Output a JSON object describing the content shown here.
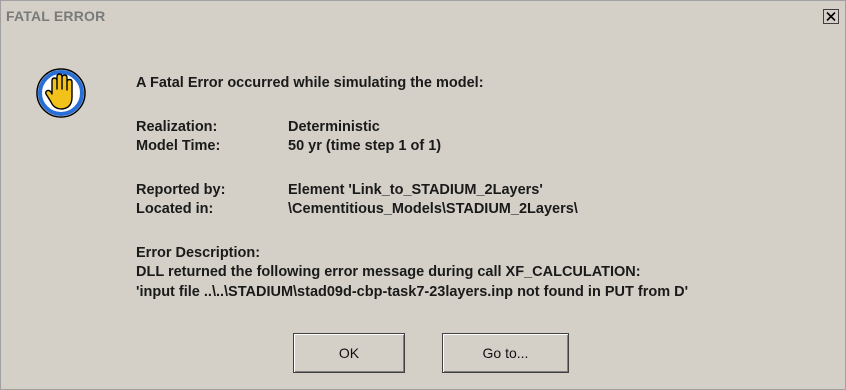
{
  "dialog": {
    "title": "FATAL ERROR",
    "close_label": "X",
    "icon": "stop-hand-icon",
    "headline": "A Fatal Error occurred while simulating the model:",
    "realization_label": "Realization:",
    "realization_value": "Deterministic",
    "model_time_label": "Model Time:",
    "model_time_value": "50 yr  (time step 1 of 1)",
    "reported_by_label": "Reported by:",
    "reported_by_value": "Element 'Link_to_STADIUM_2Layers'",
    "located_in_label": "Located in:",
    "located_in_value": "\\Cementitious_Models\\STADIUM_2Layers\\",
    "error_description_label": "Error Description:",
    "error_line_1": "DLL returned the following error message during call XF_CALCULATION:",
    "error_line_2": "'input file ..\\..\\STADIUM\\stad09d-cbp-task7-23layers.inp not found in PUT from D'",
    "ok_label": "OK",
    "goto_label": "Go to..."
  },
  "colors": {
    "dialog_bg": "#d4d0c8",
    "title_text": "#7a7a7a",
    "icon_ring": "#2a6fd6",
    "icon_hand": "#f2c21a"
  }
}
